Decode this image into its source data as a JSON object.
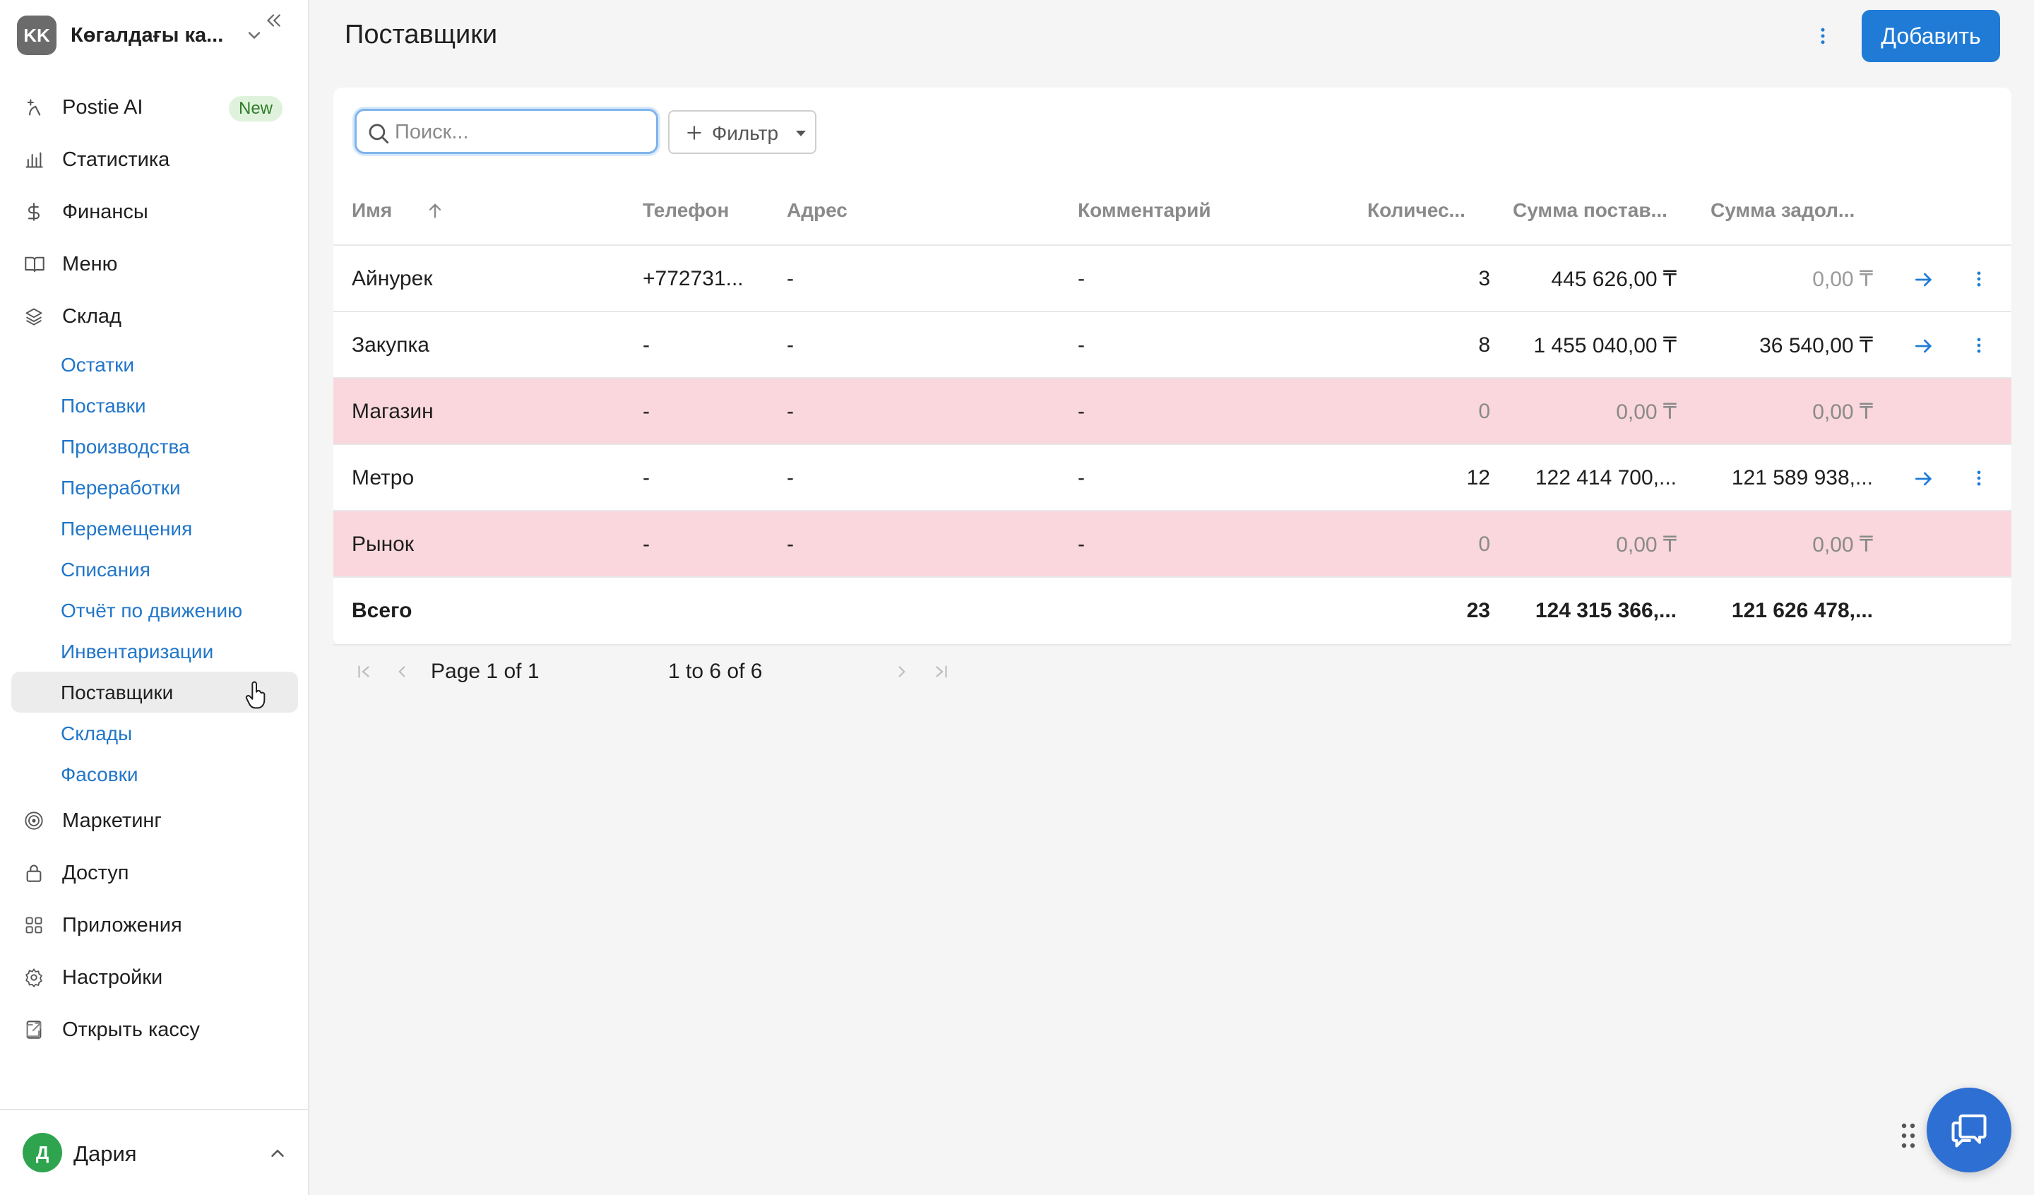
{
  "org": {
    "initials": "KK",
    "name": "Көгалдағы ка..."
  },
  "sidebar": {
    "items": [
      {
        "label": "Postie AI",
        "icon": "sparkle-icon",
        "badge": "New"
      },
      {
        "label": "Статистика",
        "icon": "bar-chart-icon"
      },
      {
        "label": "Финансы",
        "icon": "dollar-icon"
      },
      {
        "label": "Меню",
        "icon": "book-icon"
      },
      {
        "label": "Склад",
        "icon": "layers-icon"
      }
    ],
    "sklad_sub": [
      {
        "label": "Остатки"
      },
      {
        "label": "Поставки"
      },
      {
        "label": "Производства"
      },
      {
        "label": "Переработки"
      },
      {
        "label": "Перемещения"
      },
      {
        "label": "Списания"
      },
      {
        "label": "Отчёт по движению"
      },
      {
        "label": "Инвентаризации"
      },
      {
        "label": "Поставщики",
        "active": true
      },
      {
        "label": "Склады"
      },
      {
        "label": "Фасовки"
      }
    ],
    "items_bottom": [
      {
        "label": "Маркетинг",
        "icon": "target-icon"
      },
      {
        "label": "Доступ",
        "icon": "lock-icon"
      },
      {
        "label": "Приложения",
        "icon": "grid-icon"
      },
      {
        "label": "Настройки",
        "icon": "gear-icon"
      },
      {
        "label": "Открыть кассу",
        "icon": "tablet-icon",
        "external": true
      }
    ]
  },
  "user": {
    "initial": "Д",
    "name": "Дария"
  },
  "header": {
    "title": "Поставщики",
    "add_label": "Добавить"
  },
  "search": {
    "placeholder": "Поиск...",
    "value": ""
  },
  "filter": {
    "label": "Фильтр"
  },
  "table": {
    "columns": [
      "Имя",
      "Телефон",
      "Адрес",
      "Комментарий",
      "Количес...",
      "Сумма постав...",
      "Сумма задол..."
    ],
    "sort": {
      "column": "Имя",
      "direction": "asc"
    },
    "rows": [
      {
        "name": "Айнурек",
        "phone": "+772731...",
        "address": "-",
        "comment": "-",
        "count": "3",
        "supply_sum": "445 626,00 ₸",
        "debt_sum": "0,00 ₸",
        "highlight": false,
        "actions": true
      },
      {
        "name": "Закупка",
        "phone": "-",
        "address": "-",
        "comment": "-",
        "count": "8",
        "supply_sum": "1 455 040,00 ₸",
        "debt_sum": "36 540,00 ₸",
        "highlight": false,
        "actions": true
      },
      {
        "name": "Магазин",
        "phone": "-",
        "address": "-",
        "comment": "-",
        "count": "0",
        "supply_sum": "0,00 ₸",
        "debt_sum": "0,00 ₸",
        "highlight": true,
        "actions": false
      },
      {
        "name": "Метро",
        "phone": "-",
        "address": "-",
        "comment": "-",
        "count": "12",
        "supply_sum": "122 414 700,...",
        "debt_sum": "121 589 938,...",
        "highlight": false,
        "actions": true
      },
      {
        "name": "Рынок",
        "phone": "-",
        "address": "-",
        "comment": "-",
        "count": "0",
        "supply_sum": "0,00 ₸",
        "debt_sum": "0,00 ₸",
        "highlight": true,
        "actions": false
      }
    ],
    "total": {
      "label": "Всего",
      "count": "23",
      "supply_sum": "124 315 366,...",
      "debt_sum": "121 626 478,..."
    }
  },
  "pager": {
    "page_label": "Page",
    "page": "1",
    "of_label": "of",
    "pages": "1",
    "range": "1 to 6 of 6"
  },
  "colors": {
    "accent": "#1f7bd6",
    "link": "#2176c9",
    "highlight_row": "#f9d7dc",
    "badge_bg": "#dff3dc"
  }
}
